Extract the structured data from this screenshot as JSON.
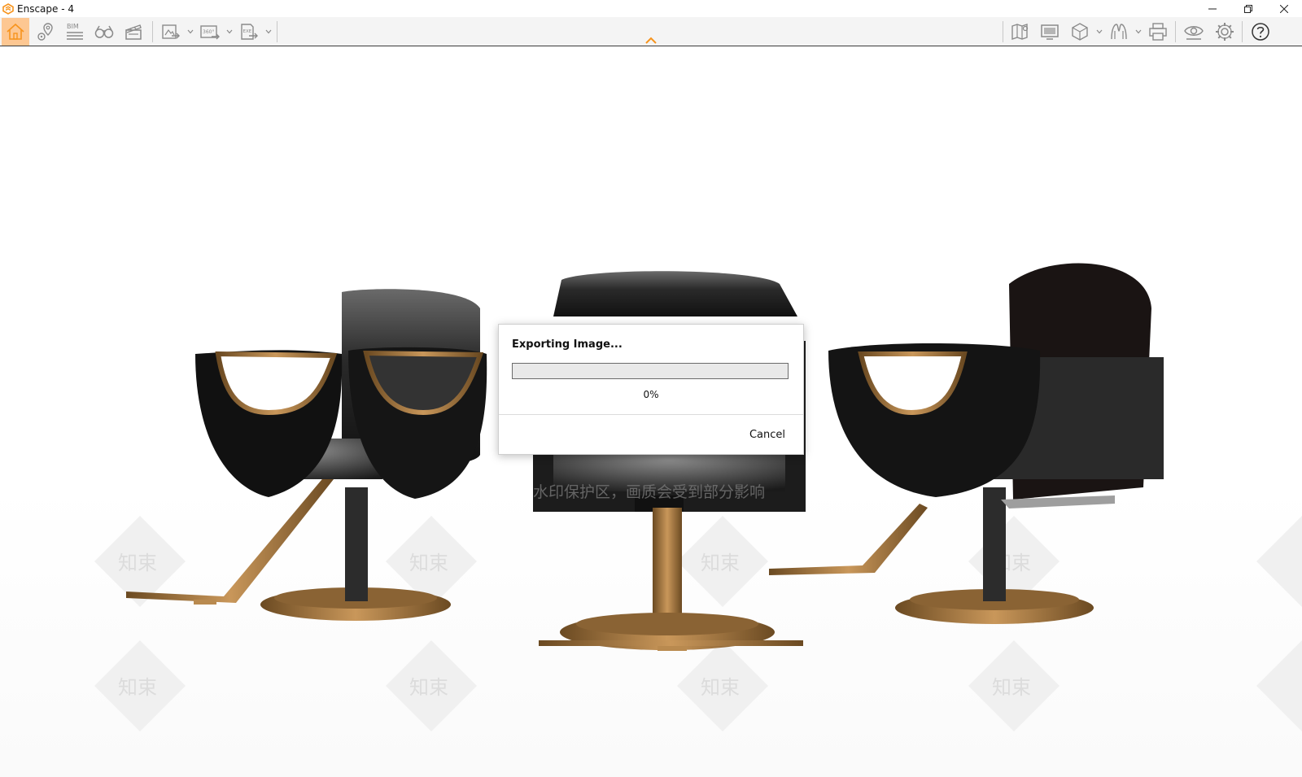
{
  "window": {
    "title": "Enscape - 4",
    "controls": [
      "minimize",
      "restore",
      "close"
    ],
    "accent_color": "#f7941d"
  },
  "toolbar": {
    "home_active_color": "#fdc792",
    "bim_label": "BIM",
    "panorama_label": "360°",
    "exe_label": "EXE",
    "left_icons": [
      "home-icon",
      "location-pin-icon",
      "bim-icon",
      "binoculars-icon",
      "clapperboard-icon",
      "screenshot-export-icon",
      "panorama-export-icon",
      "exe-export-icon"
    ],
    "right_icons": [
      "map-icon",
      "monitor-icon",
      "cube-view-icon",
      "sketch-icon",
      "printer-icon",
      "visual-eye-icon",
      "settings-gear-icon",
      "help-icon"
    ]
  },
  "dialog": {
    "title": "Exporting Image...",
    "progress_value": 0,
    "progress_text": "0%",
    "cancel_label": "Cancel"
  },
  "scene": {
    "watermark_text": "知束",
    "watermark_banner": "水印保护区，画质会受到部分影响"
  }
}
